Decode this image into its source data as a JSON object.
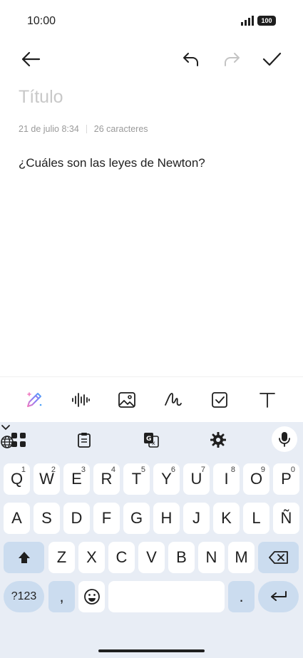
{
  "status_bar": {
    "time": "10:00",
    "battery": "100"
  },
  "editor": {
    "title_placeholder": "Título",
    "date": "21 de julio 8:34",
    "char_count": "26 caracteres",
    "body": "¿Cuáles son las leyes de Newton?"
  },
  "appbar": {
    "icons": [
      "back-arrow-icon",
      "undo-icon",
      "redo-icon",
      "check-icon"
    ]
  },
  "format_toolbar": {
    "icons": [
      "ai-magic-pen-icon",
      "audio-waveform-icon",
      "image-icon",
      "handwriting-icon",
      "checkbox-icon",
      "text-format-icon"
    ]
  },
  "keyboard": {
    "row1": [
      {
        "k": "Q",
        "s": "1"
      },
      {
        "k": "W",
        "s": "2"
      },
      {
        "k": "E",
        "s": "3"
      },
      {
        "k": "R",
        "s": "4"
      },
      {
        "k": "T",
        "s": "5"
      },
      {
        "k": "Y",
        "s": "6"
      },
      {
        "k": "U",
        "s": "7"
      },
      {
        "k": "I",
        "s": "8"
      },
      {
        "k": "O",
        "s": "9"
      },
      {
        "k": "P",
        "s": "0"
      }
    ],
    "row2": [
      "A",
      "S",
      "D",
      "F",
      "G",
      "H",
      "J",
      "K",
      "L",
      "Ñ"
    ],
    "row3": [
      "Z",
      "X",
      "C",
      "V",
      "B",
      "N",
      "M"
    ],
    "symbols_label": "?123",
    "comma": ",",
    "period": ".",
    "space": ""
  },
  "colors": {
    "keyboard_bg": "#e8edf5",
    "function_key": "#cbdcef",
    "placeholder": "#c8c8c8"
  }
}
